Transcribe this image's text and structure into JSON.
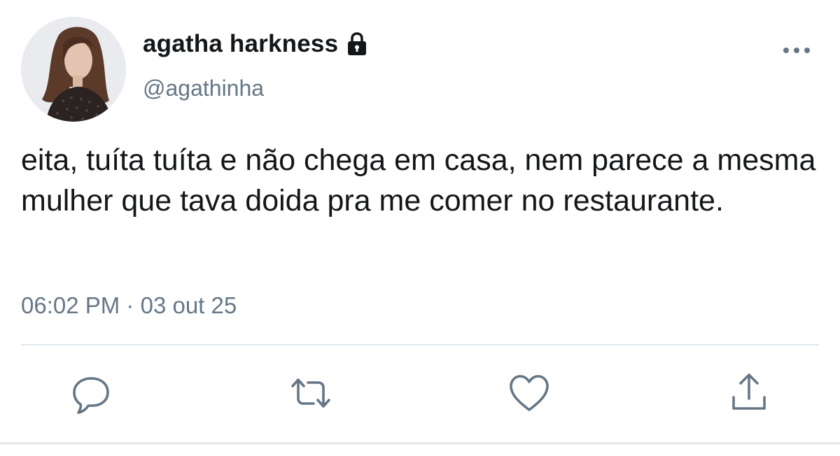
{
  "user": {
    "display_name": "agatha harkness",
    "handle": "@agathinha",
    "protected": true
  },
  "tweet": {
    "text": "eita, tuíta tuíta e não chega em casa, nem parece a mesma mulher que tava doida pra me comer no restaurante.",
    "time": "06:02 PM",
    "separator": "·",
    "date": "03 out 25"
  },
  "icons": {
    "lock": "lock-icon",
    "more": "more-horizontal-icon",
    "reply": "reply-icon",
    "retweet": "retweet-icon",
    "like": "heart-icon",
    "share": "share-icon"
  },
  "colors": {
    "text_primary": "#14171a",
    "text_secondary": "#657786",
    "icon": "#657786",
    "divider": "#e1e8ed"
  }
}
